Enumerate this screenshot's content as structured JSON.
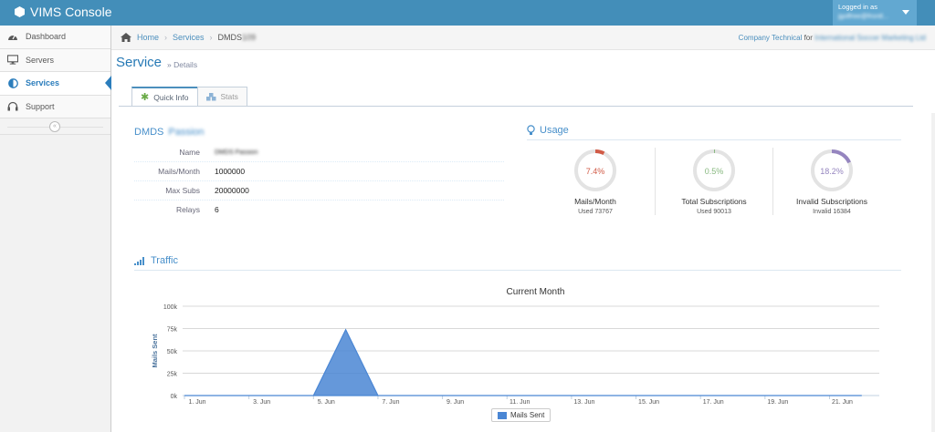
{
  "app": {
    "title": "VIMS Console"
  },
  "user": {
    "logged_in_label": "Logged in as",
    "name": "jgolfree@frontl..."
  },
  "sidebar": {
    "items": [
      {
        "label": "Dashboard",
        "icon": "tachometer-icon",
        "active": false
      },
      {
        "label": "Servers",
        "icon": "desktop-icon",
        "active": false
      },
      {
        "label": "Services",
        "icon": "adjust-icon",
        "active": true
      },
      {
        "label": "Support",
        "icon": "headphones-icon",
        "active": false
      }
    ],
    "collapse_glyph": "«"
  },
  "breadcrumb": {
    "home": "Home",
    "services": "Services",
    "current": "DMDS",
    "current_blurred": "109"
  },
  "company": {
    "name": "Company Technical",
    "for_label": "for",
    "org": "International Soccer Marketing Ltd"
  },
  "page": {
    "title": "Service",
    "subtitle": "» Details"
  },
  "tabs": [
    {
      "label": "Quick Info",
      "icon": "asterisk-icon",
      "active": true
    },
    {
      "label": "Stats",
      "icon": "cubes-icon",
      "active": false
    }
  ],
  "service": {
    "title": "DMDS",
    "title_blurred": "Passion",
    "rows": [
      {
        "label": "Name",
        "value": "DMDS Passion",
        "blurred": true
      },
      {
        "label": "Mails/Month",
        "value": "1000000",
        "blurred": false
      },
      {
        "label": "Max Subs",
        "value": "20000000",
        "blurred": false
      },
      {
        "label": "Relays",
        "value": "6",
        "blurred": false
      }
    ]
  },
  "usage": {
    "title": "Usage",
    "gauges": [
      {
        "percent": 7.4,
        "text": "7.4%",
        "color": "#d15b47",
        "label": "Mails/Month",
        "sub": "Used 73767"
      },
      {
        "percent": 0.5,
        "text": "0.5%",
        "color": "#87b87f",
        "label": "Total Subscriptions",
        "sub": "Used 90013"
      },
      {
        "percent": 18.2,
        "text": "18.2%",
        "color": "#9585bf",
        "label": "Invalid Subscriptions",
        "sub": "Invalid 16384"
      }
    ]
  },
  "traffic": {
    "title": "Traffic"
  },
  "chart_data": {
    "type": "area",
    "title": "Current Month",
    "ylabel": "Mails Sent",
    "xlabel": "",
    "ylim": [
      0,
      100000
    ],
    "y_ticks": [
      0,
      25000,
      50000,
      75000,
      100000
    ],
    "y_tick_labels": [
      "0k",
      "25k",
      "50k",
      "75k",
      "100k"
    ],
    "x_days": [
      1,
      2,
      3,
      4,
      5,
      6,
      7,
      8,
      9,
      10,
      11,
      12,
      13,
      14,
      15,
      16,
      17,
      18,
      19,
      20,
      21,
      22
    ],
    "x_tick_labels": [
      "1. Jun",
      "3. Jun",
      "5. Jun",
      "7. Jun",
      "9. Jun",
      "11. Jun",
      "13. Jun",
      "15. Jun",
      "17. Jun",
      "19. Jun",
      "21. Jun"
    ],
    "series": [
      {
        "name": "Mails Sent",
        "color": "#4a86d4",
        "values": [
          0,
          0,
          0,
          0,
          0,
          73767,
          0,
          0,
          0,
          0,
          0,
          0,
          0,
          0,
          0,
          0,
          0,
          0,
          0,
          0,
          0,
          0
        ]
      }
    ],
    "grid": true,
    "legend": "bottom-center"
  }
}
